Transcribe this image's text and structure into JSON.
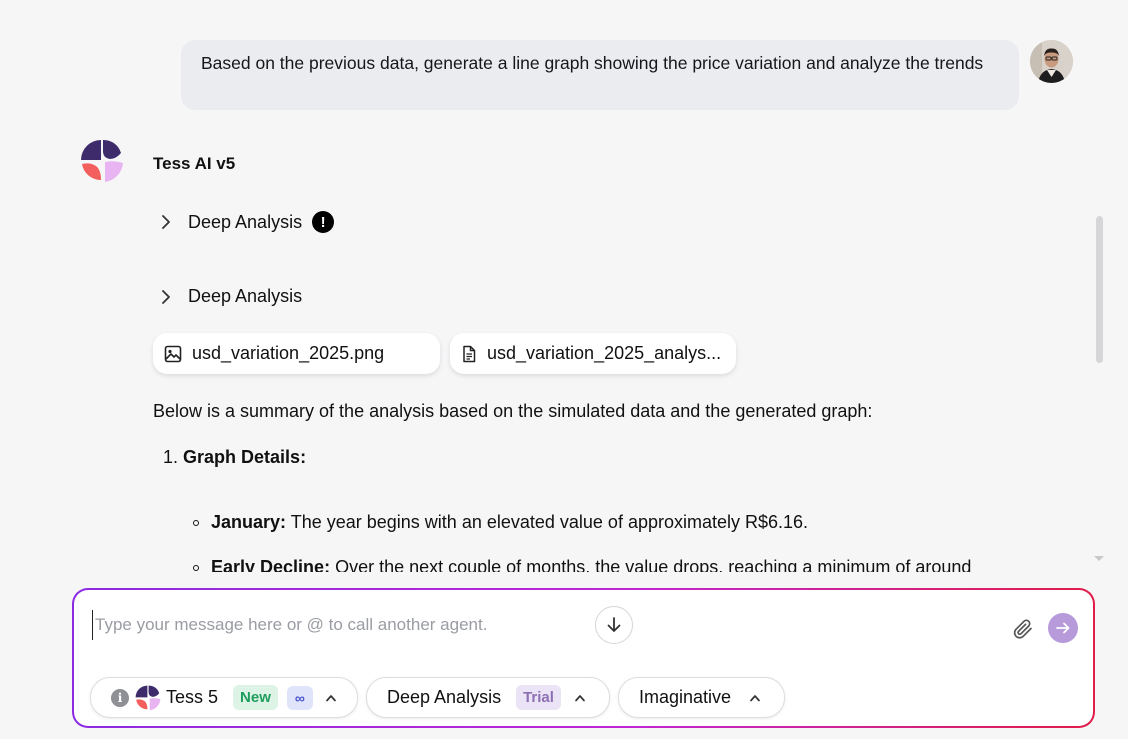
{
  "user_message": {
    "text": "Based on the previous data, generate a line graph showing the price variation and analyze the trends"
  },
  "assistant": {
    "name": "Tess AI v5",
    "steps": [
      {
        "label": "Deep Analysis",
        "has_warning": true,
        "warning_glyph": "!"
      },
      {
        "label": "Deep Analysis",
        "has_warning": false
      }
    ],
    "files": [
      {
        "name": "usd_variation_2025.png",
        "icon": "image-icon"
      },
      {
        "name": "usd_variation_2025_analys...",
        "icon": "document-icon"
      }
    ],
    "summary": "Below is a summary of the analysis based on the simulated data and the generated graph:",
    "list": {
      "number": "1.",
      "heading": "Graph Details:",
      "bullets": [
        {
          "label": "January:",
          "text": "The year begins with an elevated value of approximately R$6.16."
        },
        {
          "label": "Early Decline:",
          "text": "Over the next couple of months, the value drops, reaching a minimum of around"
        }
      ]
    }
  },
  "composer": {
    "placeholder": "Type your message here or @ to call another agent.",
    "model_pill": {
      "info": "i",
      "label": "Tess 5",
      "badge_new": "New",
      "badge_infinity": "∞"
    },
    "mode_pill": {
      "label": "Deep Analysis",
      "badge": "Trial"
    },
    "style_pill": {
      "label": "Imaginative"
    }
  },
  "colors": {
    "accent_purple": "#8b2be2",
    "accent_red": "#e11d48",
    "send_button": "#b79ad9",
    "background": "#f6f6f7"
  }
}
